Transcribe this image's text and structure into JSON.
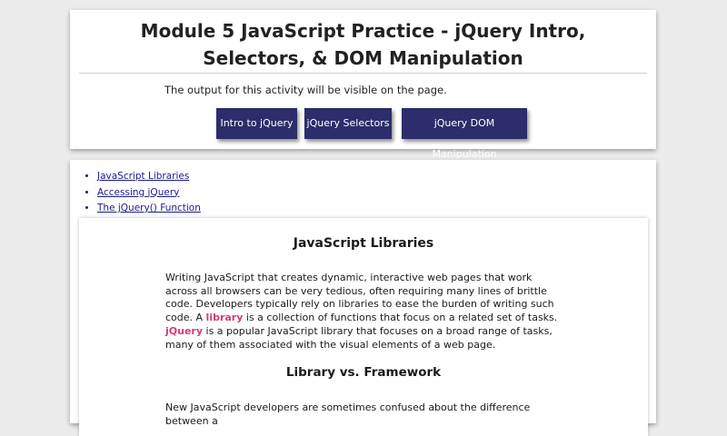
{
  "header": {
    "title": "Module 5 JavaScript Practice - jQuery Intro, Selectors, & DOM Manipulation",
    "intro": "The output for this activity will be visible on the page.",
    "buttons": [
      {
        "label": "Intro to jQuery"
      },
      {
        "label": "jQuery Selectors"
      },
      {
        "label": "jQuery DOM Manipulation"
      }
    ]
  },
  "toc": {
    "items": [
      {
        "label": "JavaScript Libraries"
      },
      {
        "label": "Accessing jQuery"
      },
      {
        "label": "The jQuery() Function"
      }
    ]
  },
  "section": {
    "heading": "JavaScript Libraries",
    "para1": {
      "text1": "Writing JavaScript that creates dynamic, interactive web pages that work across all browsers can be very tedious, often requiring many lines of brittle code. Developers typically rely on libraries to ease the burden of writing such code. A ",
      "term1": "library",
      "text2": " is a collection of functions that focus on a related set of tasks. ",
      "term2": "jQuery",
      "text3": " is a popular JavaScript library that focuses on a broad range of tasks, many of them associated with the visual elements of a web page."
    },
    "subheading": "Library vs. Framework",
    "para2": "New JavaScript developers are sometimes confused about the difference between a"
  },
  "colors": {
    "button_bg": "#2d2d6b",
    "link": "#1a1a8c",
    "term_highlight": "#d6397a",
    "page_bg": "#ececec"
  }
}
